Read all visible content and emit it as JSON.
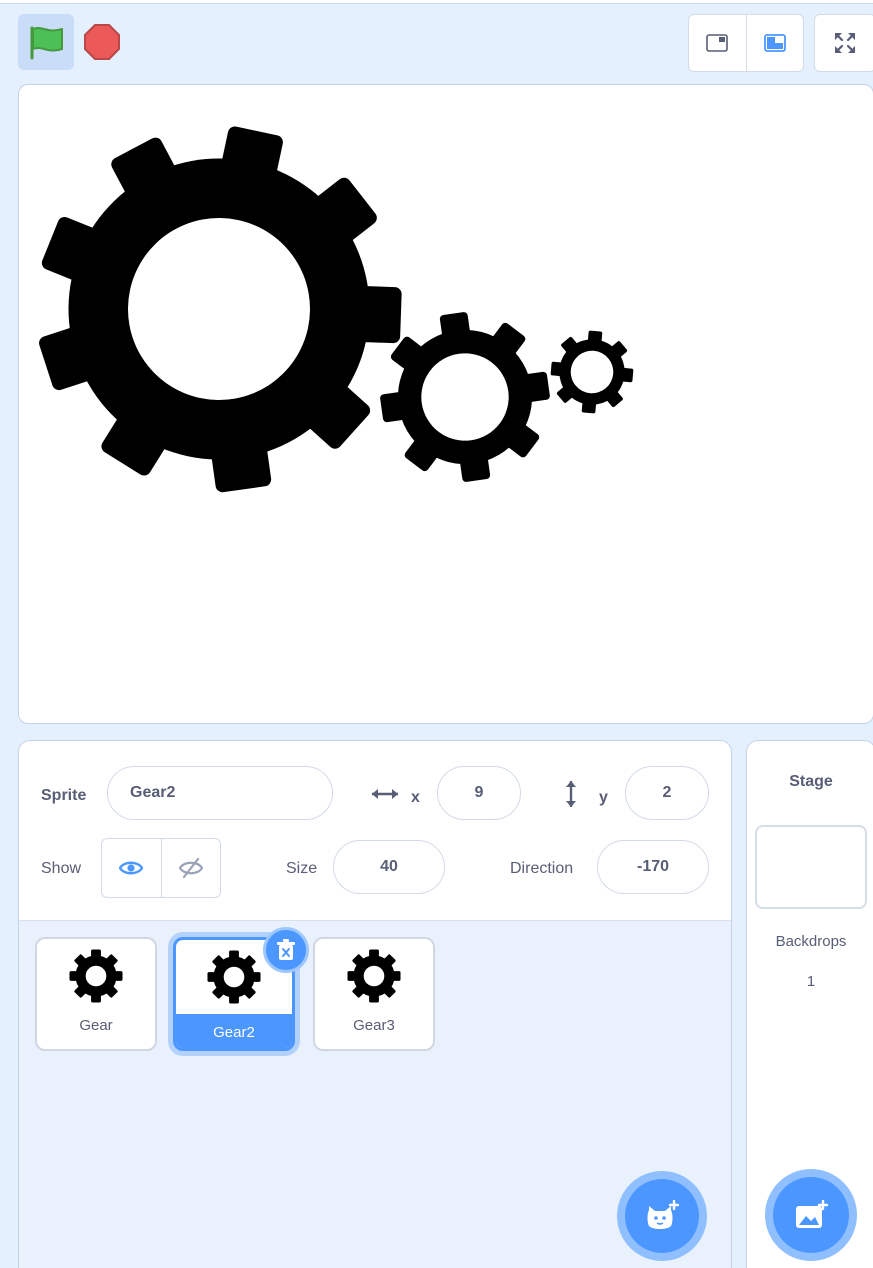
{
  "sprite_info": {
    "sprite_label": "Sprite",
    "sprite_name": "Gear2",
    "x_label": "x",
    "x_value": "9",
    "y_label": "y",
    "y_value": "2",
    "show_label": "Show",
    "size_label": "Size",
    "size_value": "40",
    "direction_label": "Direction",
    "direction_value": "-170"
  },
  "sprites": [
    {
      "name": "Gear",
      "selected": false
    },
    {
      "name": "Gear2",
      "selected": true
    },
    {
      "name": "Gear3",
      "selected": false
    }
  ],
  "stage_pane": {
    "title": "Stage",
    "backdrops_label": "Backdrops",
    "backdrops_count": "1"
  },
  "colors": {
    "accent": "#4c97ff",
    "flag": "#4cbf56",
    "stop": "#ec5959",
    "panel_bg": "#e5f0ff"
  },
  "icons": [
    "green-flag-icon",
    "stop-icon",
    "small-stage-icon",
    "large-stage-icon",
    "fullscreen-icon",
    "gear-icon",
    "trash-icon",
    "choose-sprite-icon",
    "choose-backdrop-icon",
    "eye-icon",
    "eye-slash-icon",
    "horizontal-arrows-icon",
    "vertical-arrows-icon"
  ]
}
